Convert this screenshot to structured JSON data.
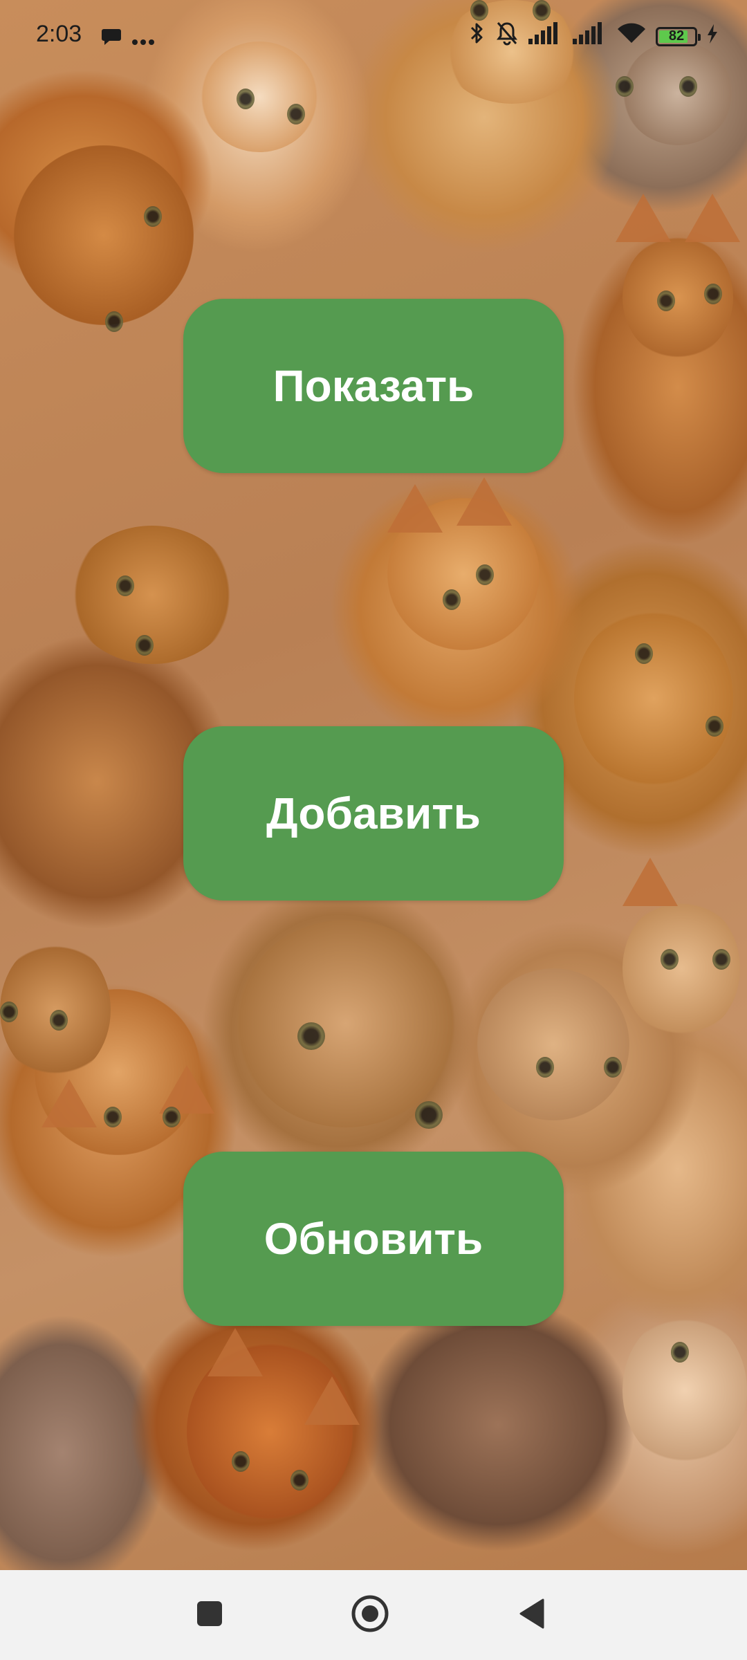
{
  "status_bar": {
    "time": "2:03",
    "battery_level": "82",
    "icons": [
      "chat-bubble-icon",
      "more-dots-icon",
      "bluetooth-icon",
      "bell-off-icon",
      "signal-icon",
      "signal-icon-2",
      "wifi-icon",
      "battery-icon",
      "charging-bolt-icon"
    ]
  },
  "main": {
    "buttons": [
      {
        "label": "Показать"
      },
      {
        "label": "Добавить"
      },
      {
        "label": "Обновить"
      }
    ],
    "button_color": "#559b50",
    "button_text_color": "#ffffff"
  },
  "nav_bar": {
    "items": [
      "recents-square-icon",
      "home-circle-icon",
      "back-triangle-icon"
    ]
  }
}
